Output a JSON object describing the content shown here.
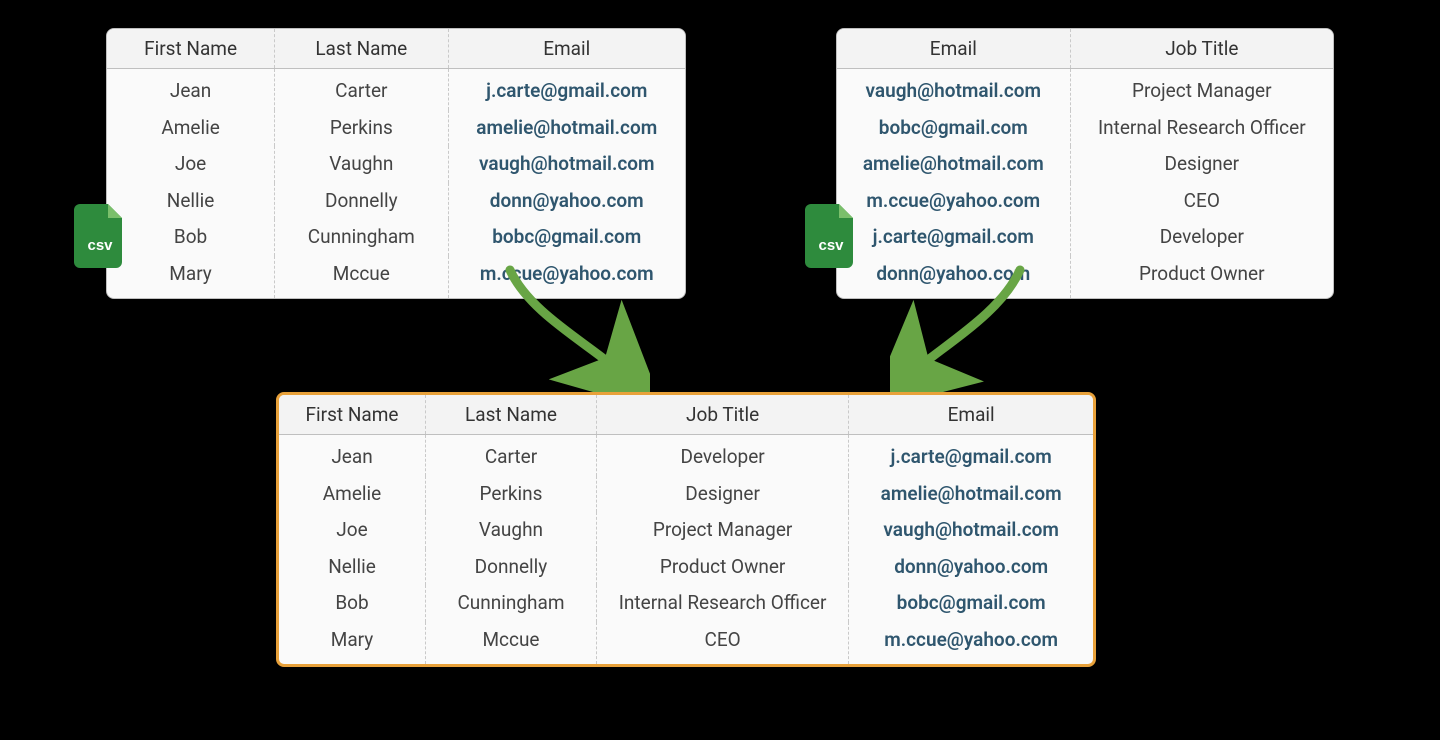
{
  "csv_label": "csv",
  "left_table": {
    "headers": [
      "First Name",
      "Last Name",
      "Email"
    ],
    "rows": [
      {
        "first": "Jean",
        "last": "Carter",
        "email": "j.carte@gmail.com"
      },
      {
        "first": "Amelie",
        "last": "Perkins",
        "email": "amelie@hotmail.com"
      },
      {
        "first": "Joe",
        "last": "Vaughn",
        "email": "vaugh@hotmail.com"
      },
      {
        "first": "Nellie",
        "last": "Donnelly",
        "email": "donn@yahoo.com"
      },
      {
        "first": "Bob",
        "last": "Cunningham",
        "email": "bobc@gmail.com"
      },
      {
        "first": "Mary",
        "last": "Mccue",
        "email": "m.ccue@yahoo.com"
      }
    ]
  },
  "right_table": {
    "headers": [
      "Email",
      "Job Title"
    ],
    "rows": [
      {
        "email": "vaugh@hotmail.com",
        "job": "Project Manager"
      },
      {
        "email": "bobc@gmail.com",
        "job": "Internal Research Officer"
      },
      {
        "email": "amelie@hotmail.com",
        "job": "Designer"
      },
      {
        "email": "m.ccue@yahoo.com",
        "job": "CEO"
      },
      {
        "email": "j.carte@gmail.com",
        "job": "Developer"
      },
      {
        "email": "donn@yahoo.com",
        "job": "Product Owner"
      }
    ]
  },
  "result_table": {
    "headers": [
      "First Name",
      "Last Name",
      "Job Title",
      "Email"
    ],
    "rows": [
      {
        "first": "Jean",
        "last": "Carter",
        "job": "Developer",
        "email": "j.carte@gmail.com"
      },
      {
        "first": "Amelie",
        "last": "Perkins",
        "job": "Designer",
        "email": "amelie@hotmail.com"
      },
      {
        "first": "Joe",
        "last": "Vaughn",
        "job": "Project Manager",
        "email": "vaugh@hotmail.com"
      },
      {
        "first": "Nellie",
        "last": "Donnelly",
        "job": "Product Owner",
        "email": "donn@yahoo.com"
      },
      {
        "first": "Bob",
        "last": "Cunningham",
        "job": "Internal Research Officer",
        "email": "bobc@gmail.com"
      },
      {
        "first": "Mary",
        "last": "Mccue",
        "job": "CEO",
        "email": "m.ccue@yahoo.com"
      }
    ]
  }
}
